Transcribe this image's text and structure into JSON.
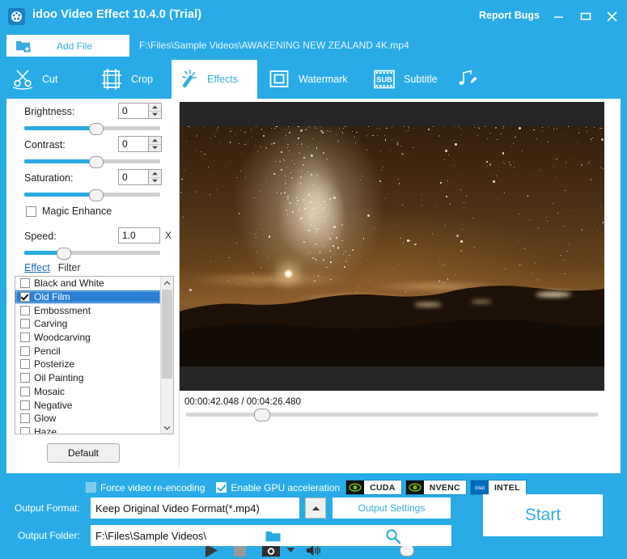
{
  "window": {
    "title": "idoo Video Effect 10.4.0 (Trial)",
    "report_bugs": "Report Bugs",
    "minimize_label": "Minimize",
    "maximize_label": "Maximize",
    "close_label": "Close",
    "brand_color": "#29abe8",
    "accent_color": "#36abe0"
  },
  "filebar": {
    "add_file_label": "Add File",
    "file_path": "F:\\Files\\Sample Videos\\AWAKENING   NEW ZEALAND 4K.mp4"
  },
  "tabs": [
    {
      "label": "Cut",
      "icon": "scissors-icon",
      "active": false
    },
    {
      "label": "Crop",
      "icon": "filmstrip-crop-icon",
      "active": false
    },
    {
      "label": "Effects",
      "icon": "magic-wand-icon",
      "active": true
    },
    {
      "label": "Watermark",
      "icon": "square-frame-icon",
      "active": false
    },
    {
      "label": "Subtitle",
      "icon": "sub-filmstrip-icon",
      "active": false
    },
    {
      "label": "",
      "icon": "music-note-pencil-icon",
      "active": false
    }
  ],
  "controls": {
    "brightness": {
      "label": "Brightness:",
      "value": "0",
      "slider_percent": 52
    },
    "contrast": {
      "label": "Contrast:",
      "value": "0",
      "slider_percent": 52
    },
    "saturation": {
      "label": "Saturation:",
      "value": "0",
      "slider_percent": 52
    },
    "magic_enhance": {
      "label": "Magic Enhance",
      "checked": false
    },
    "speed": {
      "label": "Speed:",
      "value": "1.0",
      "unit": "X",
      "slider_percent": 28
    }
  },
  "effect_tabs": {
    "effect": "Effect",
    "filter": "Filter",
    "active": "Effect"
  },
  "effects_list": [
    {
      "label": "Black and White",
      "checked": false,
      "selected": false
    },
    {
      "label": "Old Film",
      "checked": true,
      "selected": true
    },
    {
      "label": "Embossment",
      "checked": false,
      "selected": false
    },
    {
      "label": "Carving",
      "checked": false,
      "selected": false
    },
    {
      "label": "Woodcarving",
      "checked": false,
      "selected": false
    },
    {
      "label": "Pencil",
      "checked": false,
      "selected": false
    },
    {
      "label": "Posterize",
      "checked": false,
      "selected": false
    },
    {
      "label": "Oil Painting",
      "checked": false,
      "selected": false
    },
    {
      "label": "Mosaic",
      "checked": false,
      "selected": false
    },
    {
      "label": "Negative",
      "checked": false,
      "selected": false
    },
    {
      "label": "Glow",
      "checked": false,
      "selected": false
    },
    {
      "label": "Haze",
      "checked": false,
      "selected": false
    }
  ],
  "default_button": "Default",
  "player": {
    "current_time": "00:00:42.048",
    "total_time": "00:04:26.480",
    "time_display": "00:00:42.048 / 00:04:26.480",
    "seek_percent": 16,
    "volume_percent": 100,
    "play_label": "Play",
    "stop_label": "Stop",
    "snapshot_label": "Snapshot",
    "snapshot_menu_label": "Snapshot options",
    "volume_label": "Volume"
  },
  "encoding": {
    "force_reencode": {
      "label": "Force video re-encoding",
      "checked": false
    },
    "gpu_accel": {
      "label": "Enable GPU acceleration",
      "checked": true
    },
    "badges": [
      {
        "label": "CUDA",
        "icon": "nvidia-eye-icon"
      },
      {
        "label": "NVENC",
        "icon": "nvidia-eye-icon"
      },
      {
        "label": "INTEL",
        "icon": "intel-logo-icon"
      }
    ]
  },
  "output": {
    "format_label": "Output Format:",
    "format_value": "Keep Original Video Format(*.mp4)",
    "format_dropdown_icon": "chevron-up-icon",
    "settings_button": "Output Settings",
    "folder_label": "Output Folder:",
    "folder_value": "F:\\Files\\Sample Videos\\",
    "browse_icon": "folder-icon",
    "search_icon": "magnifier-icon",
    "start_button": "Start"
  }
}
